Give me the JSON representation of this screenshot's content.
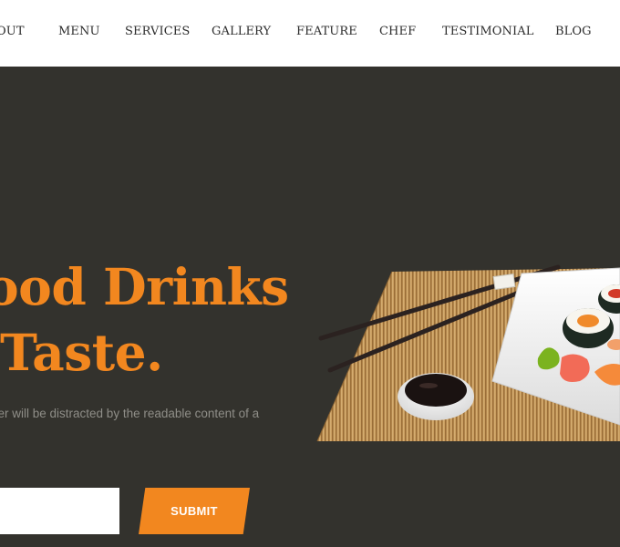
{
  "nav": {
    "items": [
      "OUT",
      "MENU",
      "SERVICES",
      "GALLERY",
      "FEATURE",
      "CHEF",
      "TESTIMONIAL",
      "BLOG"
    ]
  },
  "hero": {
    "headline_line1": "ood Drinks",
    "headline_line2": "Taste.",
    "subtext": "der will be distracted by the readable content of a",
    "email_placeholder": "",
    "submit_label": "SUBMIT"
  },
  "colors": {
    "accent": "#f2871f",
    "background": "#33322d",
    "nav_background": "#ffffff"
  },
  "icons": [
    "sushi-illustration"
  ]
}
